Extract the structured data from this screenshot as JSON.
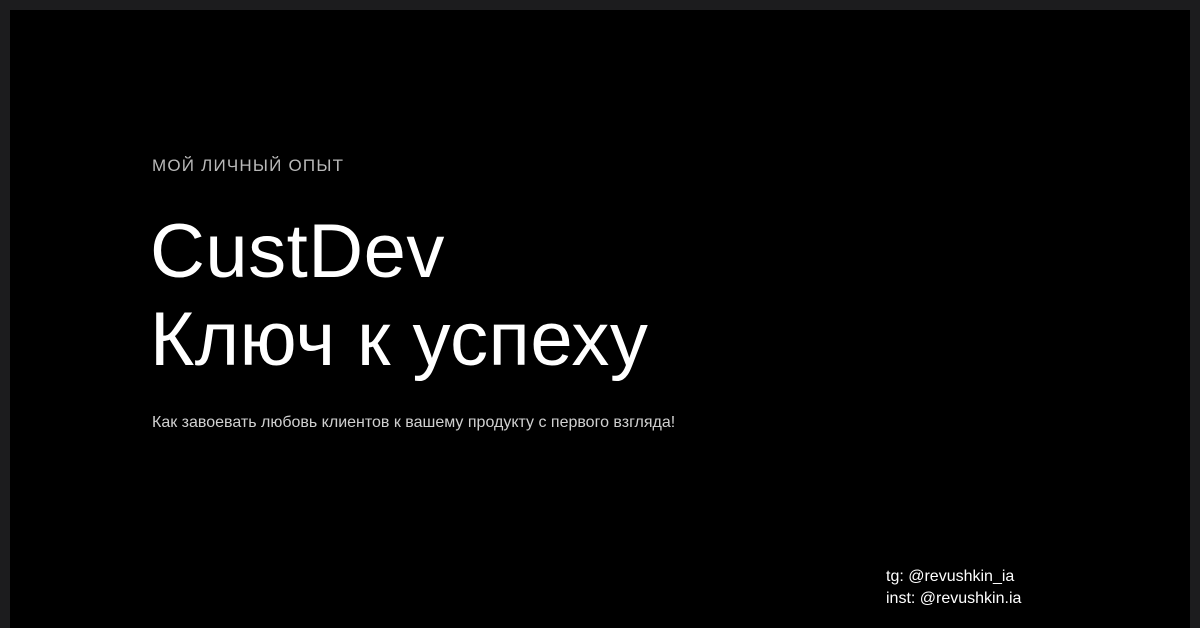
{
  "slide": {
    "eyebrow": "МОЙ ЛИЧНЫЙ ОПЫТ",
    "title_line_1": "CustDev",
    "title_line_2": "Ключ к успеху",
    "subtitle": "Как завоевать любовь клиентов к вашему продукту с первого взгляда!",
    "contacts": {
      "telegram": "tg: @revushkin_ia",
      "instagram": "inst: @revushkin.ia"
    }
  },
  "colors": {
    "frame": "#1c1c1e",
    "background": "#000000",
    "title": "#ffffff",
    "eyebrow": "#b9b9b9",
    "subtitle": "#d0d0d0"
  }
}
